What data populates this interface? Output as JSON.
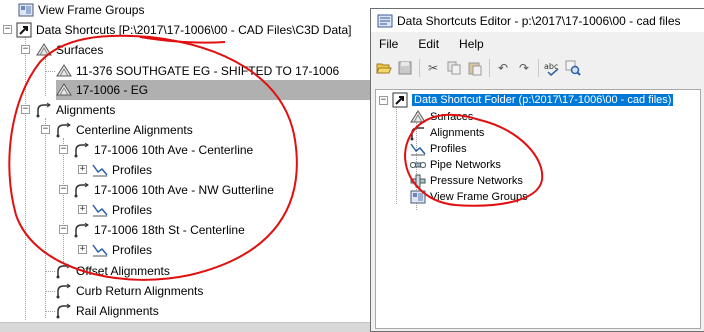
{
  "left_tree": {
    "view_frame_groups": "View Frame Groups",
    "root": "Data Shortcuts [P:\\2017\\17-1006\\00 - CAD Files\\C3D Data]",
    "surfaces": "Surfaces",
    "surface_1": "11-376 SOUTHGATE EG - SHIFTED TO 17-1006",
    "surface_2": "17-1006 - EG",
    "alignments": "Alignments",
    "centerline_alignments": "Centerline Alignments",
    "align_1": "17-1006 10th Ave - Centerline",
    "align_2": "17-1006 10th Ave - NW Gutterline",
    "align_3": "17-1006 18th St - Centerline",
    "profiles": "Profiles",
    "offset_alignments": "Offset Alignments",
    "curb_return_alignments": "Curb Return Alignments",
    "rail_alignments": "Rail Alignments"
  },
  "dialog": {
    "title": "Data Shortcuts Editor - p:\\2017\\17-1006\\00 - cad files",
    "menu": [
      "File",
      "Edit",
      "Help"
    ],
    "toolbar_icons": [
      "open-icon",
      "save-icon",
      "cut-icon",
      "copy-icon",
      "paste-icon",
      "undo-icon",
      "redo-icon",
      "spell-check-icon",
      "find-icon"
    ],
    "tree_root": "Data Shortcut Folder (p:\\2017\\17-1006\\00 - cad files)",
    "tree_items": [
      "Surfaces",
      "Alignments",
      "Profiles",
      "Pipe Networks",
      "Pressure Networks",
      "View Frame Groups"
    ]
  },
  "colors": {
    "selection_gray": "#b0b0b0",
    "selection_blue": "#0078d7",
    "annotation_red": "#e01010"
  }
}
